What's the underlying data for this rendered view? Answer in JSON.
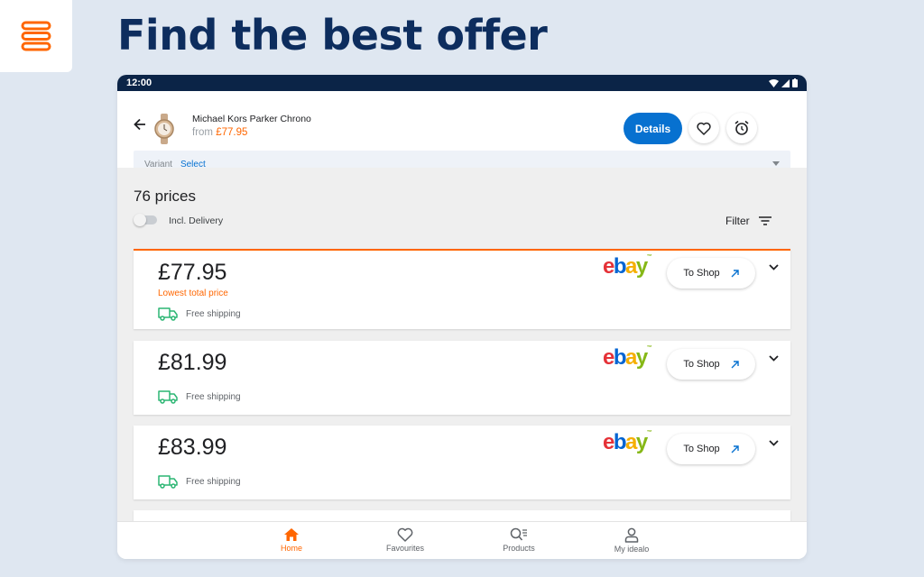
{
  "headline": "Find the best offer",
  "status_bar": {
    "time": "12:00"
  },
  "product": {
    "name": "Michael Kors Parker Chrono",
    "from_label": "from",
    "from_price": "£77.95"
  },
  "actions": {
    "details_label": "Details"
  },
  "variant": {
    "label": "Variant",
    "value": "Select"
  },
  "offers_header": {
    "count": "76 prices",
    "delivery_toggle_label": "Incl. Delivery",
    "delivery_toggle_on": false,
    "filter_label": "Filter"
  },
  "offers": [
    {
      "price": "£77.95",
      "badge": "Lowest total price",
      "shipping": "Free shipping",
      "shop": "ebay",
      "cta": "To Shop"
    },
    {
      "price": "£81.99",
      "shipping": "Free shipping",
      "shop": "ebay",
      "cta": "To Shop"
    },
    {
      "price": "£83.99",
      "shipping": "Free shipping",
      "shop": "ebay",
      "cta": "To Shop"
    }
  ],
  "bottom_nav": [
    {
      "label": "Home",
      "icon": "home-icon",
      "active": true
    },
    {
      "label": "Favourites",
      "icon": "heart-icon",
      "active": false
    },
    {
      "label": "Products",
      "icon": "product-search-icon",
      "active": false
    },
    {
      "label": "My idealo",
      "icon": "user-icon",
      "active": false
    }
  ],
  "colors": {
    "brand_orange": "#ff6600",
    "primary_blue": "#0771d0",
    "headline_navy": "#0d2d5e",
    "status_bar": "#0b2447",
    "shipping_green": "#2bb673",
    "background": "#dfe7f1"
  }
}
